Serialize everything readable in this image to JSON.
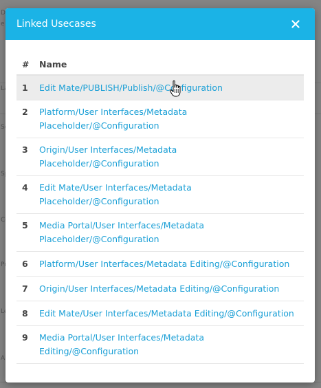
{
  "modal": {
    "title": "Linked Usecases",
    "close_glyph": "×"
  },
  "table": {
    "headers": {
      "num": "#",
      "name": "Name"
    },
    "rows": [
      {
        "num": "1",
        "lines": [
          "Edit Mate/PUBLISH/Publish/@Configuration"
        ]
      },
      {
        "num": "2",
        "lines": [
          "Platform/User Interfaces/Metadata",
          "Placeholder/@Configuration"
        ]
      },
      {
        "num": "3",
        "lines": [
          "Origin/User Interfaces/Metadata",
          "Placeholder/@Configuration"
        ]
      },
      {
        "num": "4",
        "lines": [
          "Edit Mate/User Interfaces/Metadata",
          "Placeholder/@Configuration"
        ]
      },
      {
        "num": "5",
        "lines": [
          "Media Portal/User Interfaces/Metadata",
          "Placeholder/@Configuration"
        ]
      },
      {
        "num": "6",
        "lines": [
          "Platform/User Interfaces/Metadata Editing/@Configuration"
        ]
      },
      {
        "num": "7",
        "lines": [
          "Origin/User Interfaces/Metadata Editing/@Configuration"
        ]
      },
      {
        "num": "8",
        "lines": [
          "Edit Mate/User Interfaces/Metadata Editing/@Configuration"
        ]
      },
      {
        "num": "9",
        "lines": [
          "Media Portal/User Interfaces/Metadata",
          "Editing/@Configuration"
        ]
      }
    ]
  },
  "background_fragments": [
    "DA",
    "e",
    "La",
    "Se",
    "Sp",
    "Co",
    "Pr",
    "Le",
    "A"
  ],
  "colors": {
    "header": "#1bb3e6",
    "link": "#1a9fd6",
    "row_highlight": "#ececec"
  },
  "cursor_icon": "hand-pointer-icon"
}
